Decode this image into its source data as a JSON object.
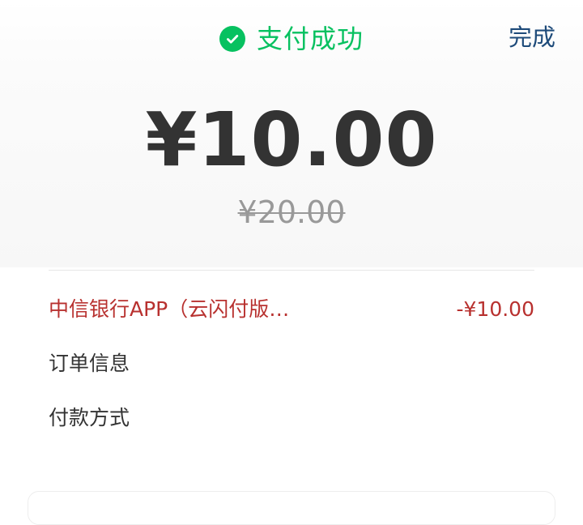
{
  "colors": {
    "accent": "#07c160",
    "link": "#1e4b7a",
    "merchant": "#b8312f"
  },
  "header": {
    "status_icon": "check-circle-icon",
    "status_title": "支付成功",
    "done_label": "完成"
  },
  "payment": {
    "amount": "¥10.00",
    "original_amount": "¥20.00"
  },
  "details": {
    "merchant_name": "中信银行APP（云闪付版…",
    "merchant_amount": "-¥10.00",
    "order_info_label": "订单信息",
    "payment_method_label": "付款方式"
  }
}
